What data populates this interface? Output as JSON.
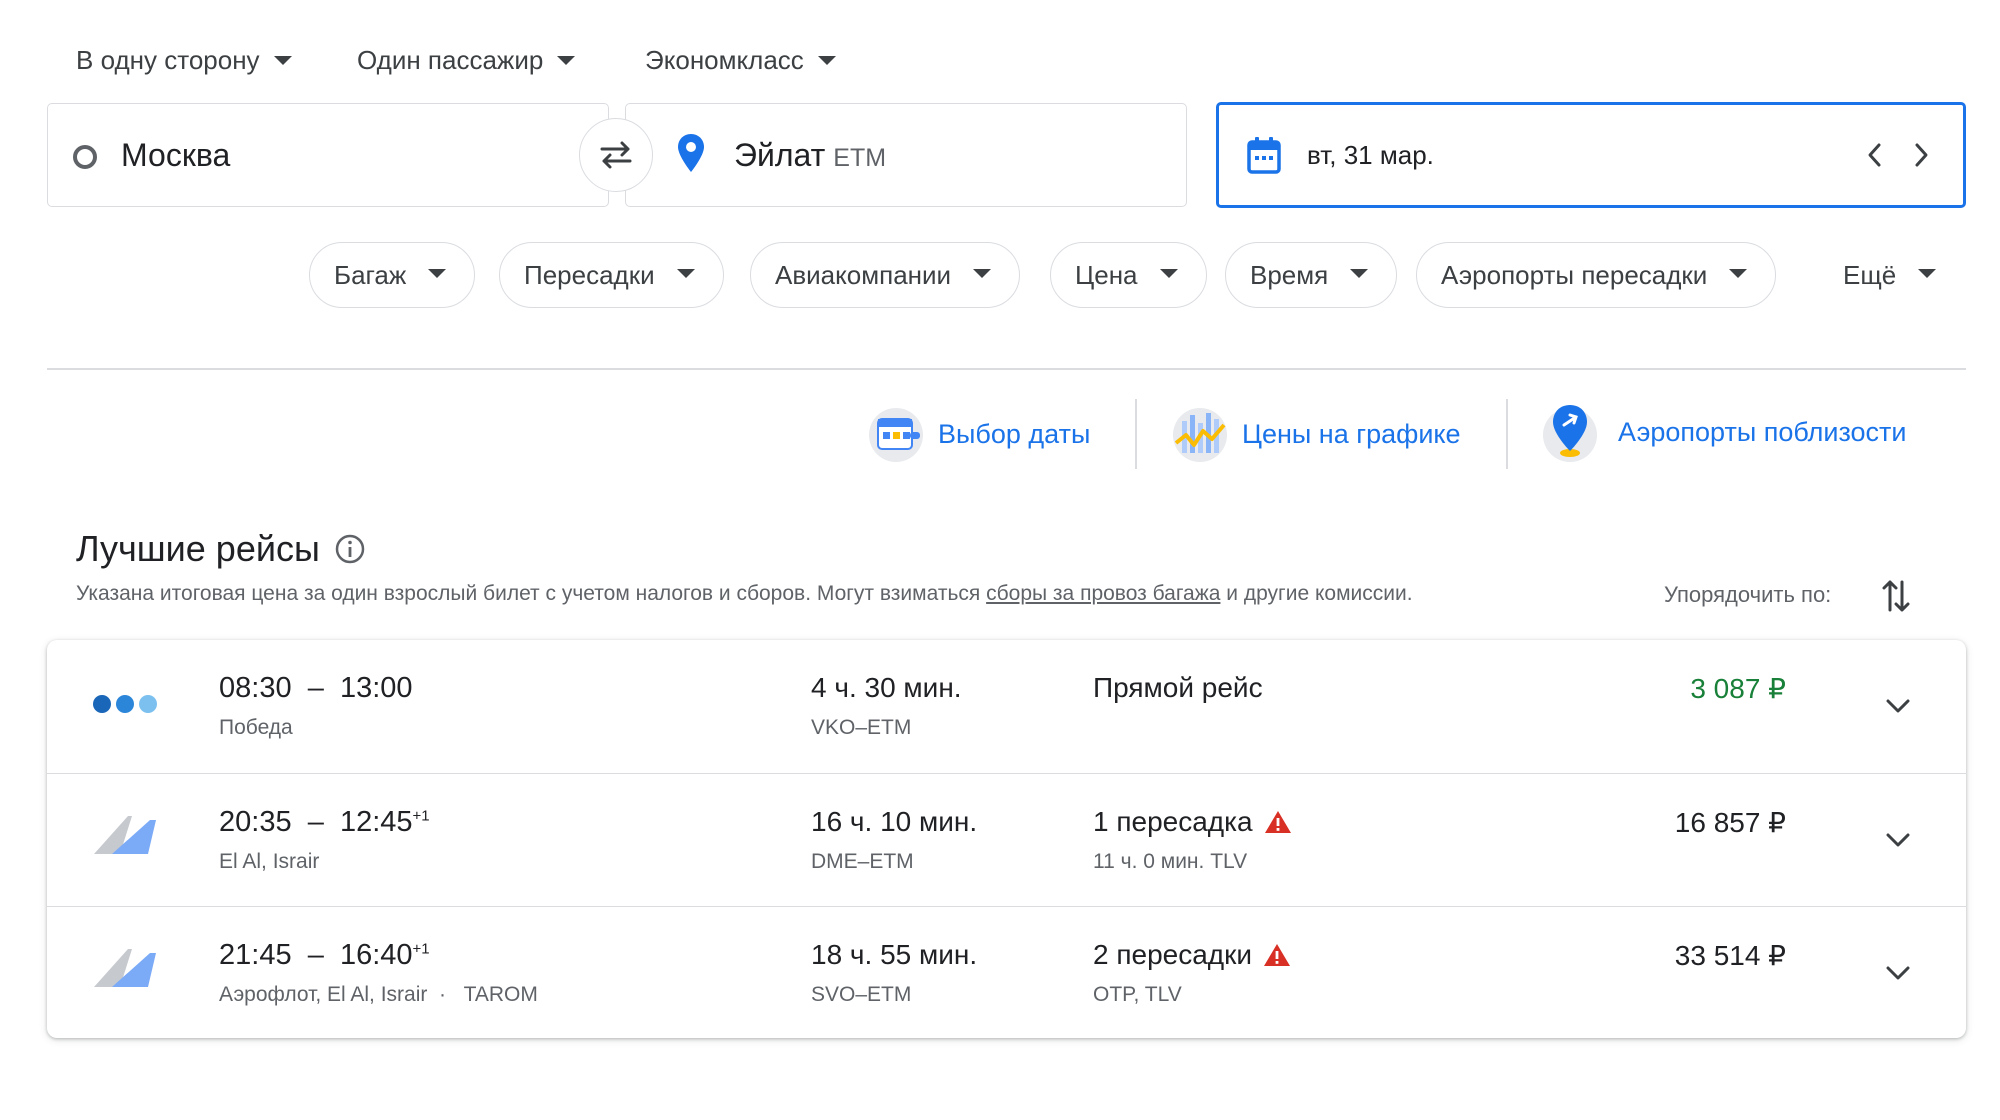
{
  "colors": {
    "accent": "#1a73e8",
    "green_price": "#188038",
    "warning": "#d93025",
    "border": "#dadce0"
  },
  "top_selectors": [
    {
      "label": "В одну сторону"
    },
    {
      "label": "Один пассажир"
    },
    {
      "label": "Экономкласс"
    }
  ],
  "search": {
    "origin": "Москва",
    "destination_city": "Эйлат",
    "destination_code": "ETM",
    "date": "вт, 31 мар."
  },
  "filters": [
    "Багаж",
    "Пересадки",
    "Авиакомпании",
    "Цена",
    "Время",
    "Аэропорты пересадки",
    "Ещё"
  ],
  "insights": [
    {
      "label": "Выбор даты",
      "icon": "calendar-grid-icon"
    },
    {
      "label": "Цены на графике",
      "icon": "price-chart-icon"
    },
    {
      "label": "Аэропорты поблизости",
      "icon": "nearby-airports-pin-icon"
    }
  ],
  "results": {
    "title": "Лучшие рейсы",
    "note_before": "Указана итоговая цена за один взрослый билет с учетом налогов и сборов. Могут взиматься",
    "note_link": "сборы за провоз багажа",
    "note_after": "и другие комиссии.",
    "sort_label": "Упорядочить по:",
    "flights": [
      {
        "depart": "08:30",
        "arrive": "13:00",
        "arrive_suffix": "",
        "airline": "Победа",
        "airline_extra": "",
        "duration": "4 ч. 30 мин.",
        "route": "VKO–ETM",
        "stops": "Прямой рейс",
        "stops_detail": "",
        "warning": false,
        "price": "3 087 ₽",
        "price_highlight": true
      },
      {
        "depart": "20:35",
        "arrive": "12:45",
        "arrive_suffix": "+1",
        "airline": "El Al, Israir",
        "airline_extra": "",
        "duration": "16 ч. 10 мин.",
        "route": "DME–ETM",
        "stops": "1 пересадка",
        "stops_detail": "11 ч. 0 мин. TLV",
        "warning": true,
        "price": "16 857 ₽",
        "price_highlight": false
      },
      {
        "depart": "21:45",
        "arrive": "16:40",
        "arrive_suffix": "+1",
        "airline": "Аэрофлот, El Al, Israir",
        "airline_extra": "TAROM",
        "duration": "18 ч. 55 мин.",
        "route": "SVO–ETM",
        "stops": "2 пересадки",
        "stops_detail": "OTP, TLV",
        "warning": true,
        "price": "33 514 ₽",
        "price_highlight": false
      }
    ]
  }
}
